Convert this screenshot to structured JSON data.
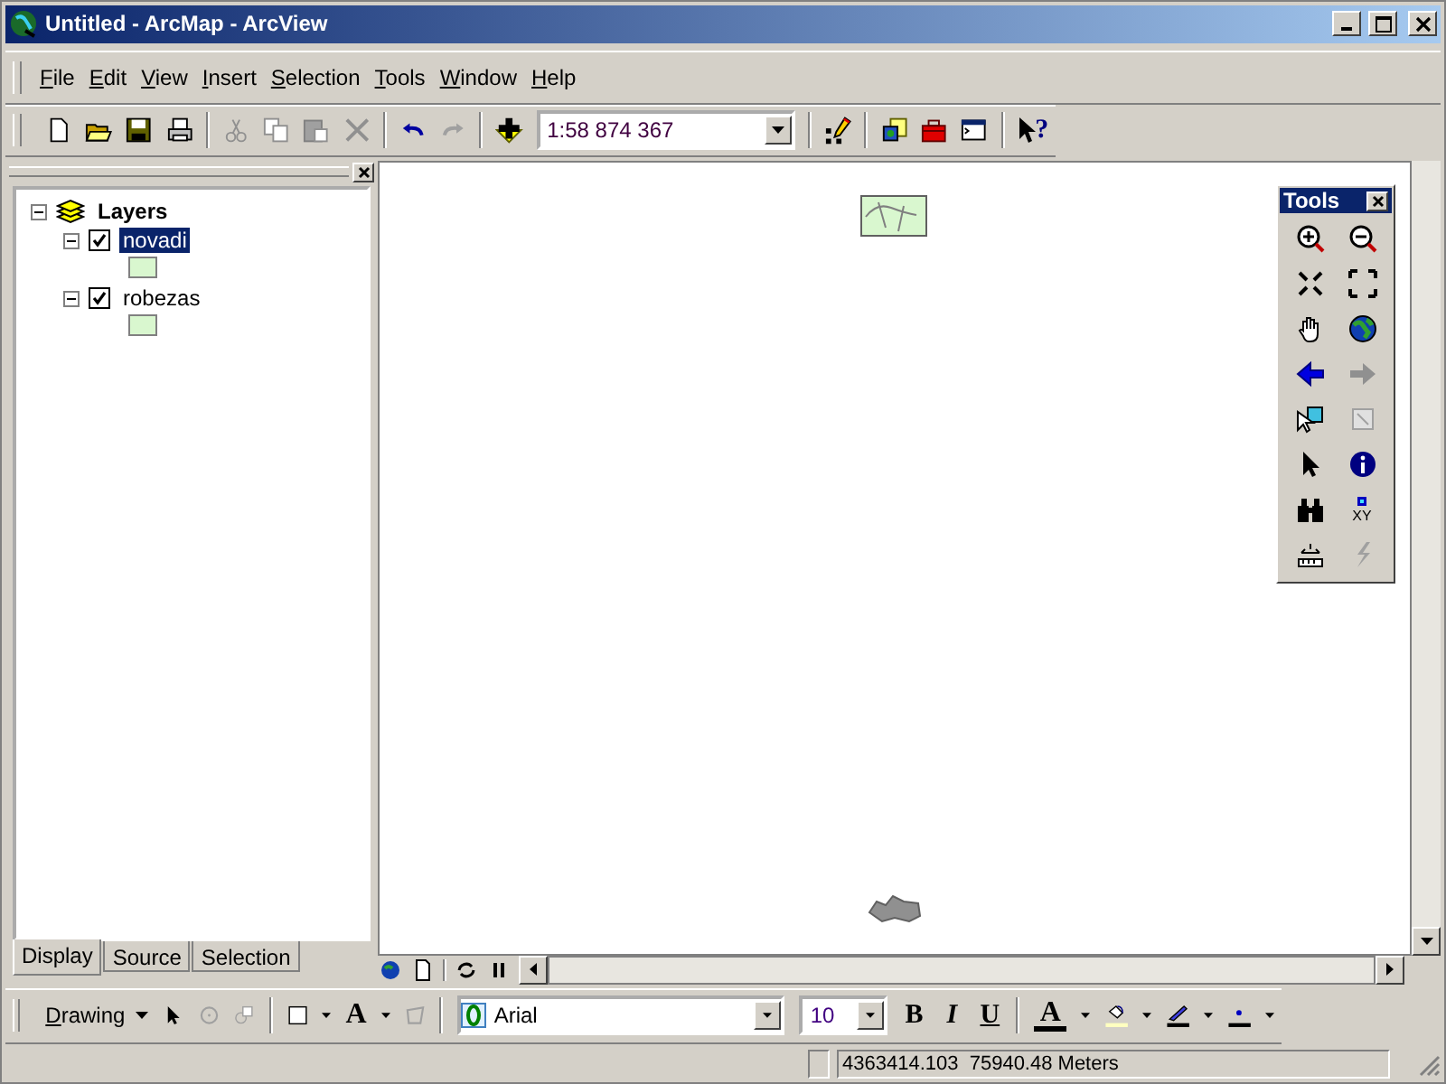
{
  "window": {
    "title": "Untitled - ArcMap - ArcView"
  },
  "menu": [
    {
      "label": "File"
    },
    {
      "label": "Edit"
    },
    {
      "label": "View"
    },
    {
      "label": "Insert"
    },
    {
      "label": "Selection"
    },
    {
      "label": "Tools"
    },
    {
      "label": "Window"
    },
    {
      "label": "Help"
    }
  ],
  "toolbar": {
    "scale": "1:58 874 367",
    "help_glyph": "?"
  },
  "toc": {
    "root": {
      "label": "Layers",
      "expanded": true,
      "children": [
        {
          "label": "novadi",
          "checked": true,
          "selected": true,
          "expanded": true,
          "color": "#d9f7cf"
        },
        {
          "label": "robezas",
          "checked": true,
          "selected": false,
          "expanded": true,
          "color": "#d9f7cf"
        }
      ]
    },
    "tabs": [
      {
        "label": "Display",
        "selected": true
      },
      {
        "label": "Source",
        "selected": false
      },
      {
        "label": "Selection",
        "selected": false
      }
    ]
  },
  "tools_window": {
    "title": "Tools",
    "xy_label": "XY"
  },
  "drawing_toolbar": {
    "menu": "Drawing",
    "text_glyph": "A",
    "font": "Arial",
    "size": "10",
    "format": [
      {
        "label": "B",
        "kind": "bold"
      },
      {
        "label": "I",
        "kind": "italic"
      },
      {
        "label": "U",
        "kind": "underline"
      }
    ],
    "font_color_glyph": "A"
  },
  "status_bar": {
    "coordinates": "4363414.103  75940.48 Meters"
  }
}
